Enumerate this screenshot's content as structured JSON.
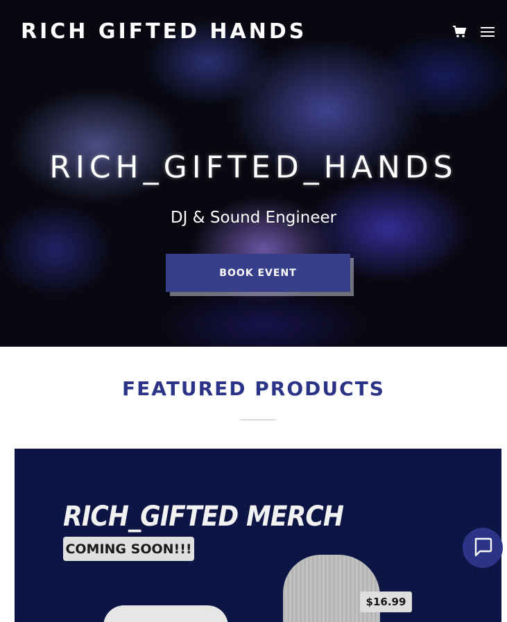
{
  "header": {
    "logo_text": "RICH GIFTED HANDS",
    "cart_icon": "shopping-cart-icon",
    "menu_icon": "hamburger-menu-icon"
  },
  "hero": {
    "heading": "RICH_GIFTED_HANDS",
    "subheading": "DJ & Sound Engineer",
    "cta_label": "BOOK EVENT"
  },
  "featured": {
    "title": "FEATURED PRODUCTS",
    "product_image": {
      "headline": "RICH_GIFTED MERCH",
      "badge": "COMING SOON!!!",
      "price": "$16.99"
    }
  },
  "chat": {
    "icon": "chat-bubble-icon"
  },
  "colors": {
    "brand_navy": "#2b3487",
    "button_bg": "#373f8a",
    "product_bg": "#0c1544",
    "white": "#ffffff"
  }
}
